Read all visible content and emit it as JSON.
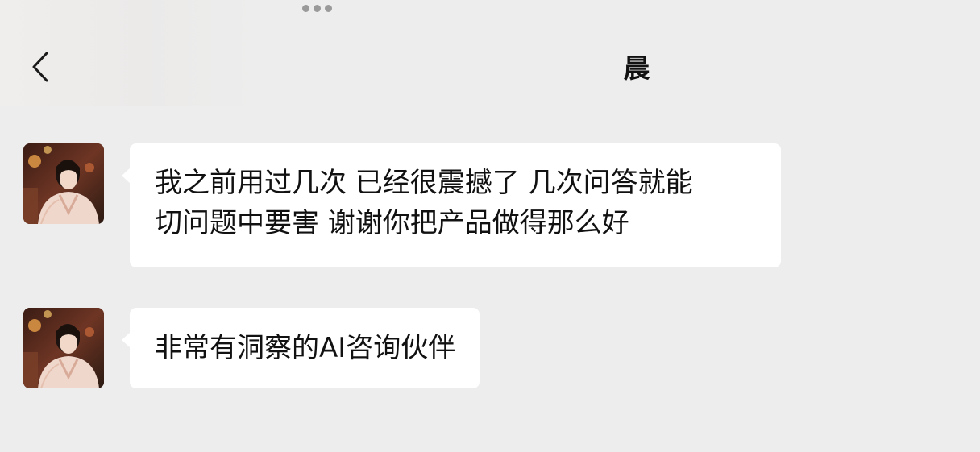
{
  "header": {
    "title": "晨",
    "back_icon": "chevron-left-icon",
    "more_icon": "ellipsis-icon"
  },
  "messages": [
    {
      "sender": "晨",
      "avatar": "avatar-photo",
      "text": "我之前用过几次 已经很震撼了 几次问答就能\n切问题中要害 谢谢你把产品做得那么好"
    },
    {
      "sender": "晨",
      "avatar": "avatar-photo",
      "text": "非常有洞察的AI咨询伙伴"
    }
  ],
  "colors": {
    "background": "#ededed",
    "bubble": "#ffffff",
    "text": "#111111"
  }
}
